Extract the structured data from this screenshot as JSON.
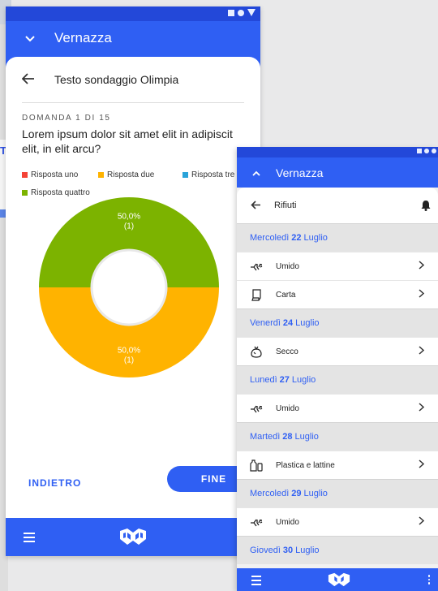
{
  "survey": {
    "status_icons": [
      "square-icon",
      "circle-icon",
      "triangle-icon"
    ],
    "app_title": "Vernazza",
    "header_title": "Testo sondaggio Olimpia",
    "question_counter": "DOMANDA 1 DI 15",
    "question_text": "Lorem ipsum dolor sit amet elit in adipiscit elit, in elit arcu?",
    "legend": [
      {
        "label": "Risposta uno",
        "color": "#f44336"
      },
      {
        "label": "Risposta due",
        "color": "#ffb300"
      },
      {
        "label": "Risposta tre",
        "color": "#29a3d9"
      },
      {
        "label": "Risposta quattro",
        "color": "#7cb300"
      }
    ],
    "back_button": "INDIETRO",
    "end_button": "FINE"
  },
  "chart_data": {
    "type": "pie",
    "categories": [
      "Risposta uno",
      "Risposta due",
      "Risposta tre",
      "Risposta quattro"
    ],
    "values": [
      0,
      1,
      0,
      1
    ],
    "percent": [
      "0,0%",
      "50,0%",
      "0,0%",
      "50,0%"
    ],
    "colors": [
      "#f44336",
      "#ffb300",
      "#29a3d9",
      "#7cb300"
    ],
    "donut": true,
    "slice_labels": [
      {
        "category": "Risposta quattro",
        "percent": "50,0%",
        "count": "(1)"
      },
      {
        "category": "Risposta due",
        "percent": "50,0%",
        "count": "(1)"
      }
    ]
  },
  "waste": {
    "app_title": "Vernazza",
    "header_title": "Rifiuti",
    "days": [
      {
        "weekday": "Mercoledì",
        "num": "22",
        "month": "Luglio",
        "items": [
          {
            "label": "Umido",
            "icon": "fishbone-icon"
          },
          {
            "label": "Carta",
            "icon": "paper-icon"
          }
        ]
      },
      {
        "weekday": "Venerdì",
        "num": "24",
        "month": "Luglio",
        "items": [
          {
            "label": "Secco",
            "icon": "trash-bag-icon"
          }
        ]
      },
      {
        "weekday": "Lunedì",
        "num": "27",
        "month": "Luglio",
        "items": [
          {
            "label": "Umido",
            "icon": "fishbone-icon"
          }
        ]
      },
      {
        "weekday": "Martedì",
        "num": "28",
        "month": "Luglio",
        "items": [
          {
            "label": "Plastica e lattine",
            "icon": "bottle-can-icon"
          }
        ]
      },
      {
        "weekday": "Mercoledì",
        "num": "29",
        "month": "Luglio",
        "items": [
          {
            "label": "Umido",
            "icon": "fishbone-icon"
          }
        ]
      },
      {
        "weekday": "Giovedì",
        "num": "30",
        "month": "Luglio",
        "items": []
      }
    ]
  }
}
